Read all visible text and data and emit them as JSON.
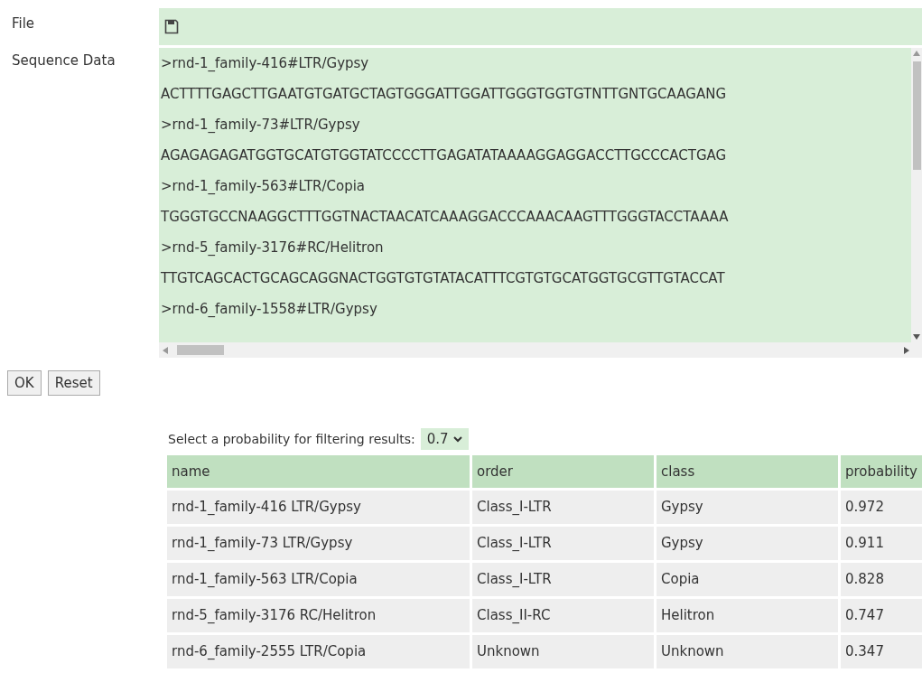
{
  "file_field": {
    "label": "File"
  },
  "sequence_field": {
    "label": "Sequence Data",
    "lines": [
      ">rnd-1_family-416#LTR/Gypsy",
      "ACTTTTGAGCTTGAATGTGATGCTAGTGGGATTGGATTGGGTGGTGTNTTGNTGCAAGANG",
      ">rnd-1_family-73#LTR/Gypsy",
      "AGAGAGAGATGGTGCATGTGGTATCCCCTTGAGATATAAAAGGAGGACCTTGCCCACTGAG",
      ">rnd-1_family-563#LTR/Copia",
      "TGGGTGCCNAAGGCTTTGGTNACTAACATCAAAGGACCCAAACAAGTTTGGGTACCTAAAA",
      ">rnd-5_family-3176#RC/Helitron",
      "TTGTCAGCACTGCAGCAGGNACTGGTGTGTATACATTTCGTGTGCATGGTGCGTTGTACCAT",
      ">rnd-6_family-1558#LTR/Gypsy"
    ]
  },
  "buttons": [
    "OK",
    "Reset"
  ],
  "filter": {
    "label": "Select a probability for filtering results:",
    "value": "0.7"
  },
  "table": {
    "columns": [
      "name",
      "order",
      "class",
      "probability"
    ],
    "rows": [
      [
        "rnd-1_family-416 LTR/Gypsy",
        "Class_I-LTR",
        "Gypsy",
        "0.972"
      ],
      [
        "rnd-1_family-73 LTR/Gypsy",
        "Class_I-LTR",
        "Gypsy",
        "0.911"
      ],
      [
        "rnd-1_family-563 LTR/Copia",
        "Class_I-LTR",
        "Copia",
        "0.828"
      ],
      [
        "rnd-5_family-3176 RC/Helitron",
        "Class_II-RC",
        "Helitron",
        "0.747"
      ],
      [
        "rnd-6_family-2555 LTR/Copia",
        "Unknown",
        "Unknown",
        "0.347"
      ]
    ]
  }
}
